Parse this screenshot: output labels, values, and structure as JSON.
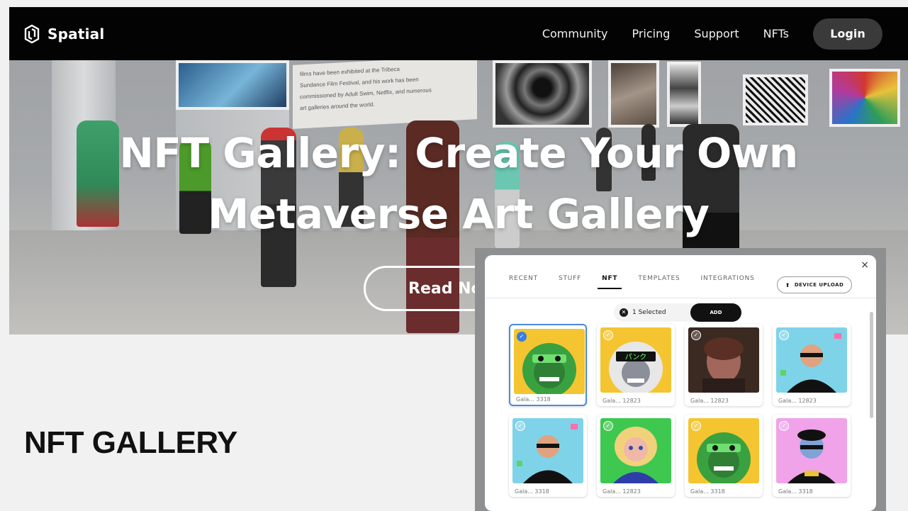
{
  "header": {
    "logo_text": "Spatial",
    "nav": [
      "Community",
      "Pricing",
      "Support",
      "NFTs"
    ],
    "login_label": "Login"
  },
  "hero": {
    "title_line1": "NFT Gallery: Create Your Own",
    "title_line2": "Metaverse Art Gallery",
    "cta_label": "Read Now",
    "info_panel_lines": [
      "films have been exhibited at the Tribeca",
      "Sundance Film Festival, and his work has been",
      "commissioned by Adult Swim, Netflix, and numerous",
      "art galleries around the world."
    ]
  },
  "section_title": "NFT GALLERY",
  "modal": {
    "close_glyph": "×",
    "tabs": [
      "RECENT",
      "STUFF",
      "NFT",
      "TEMPLATES",
      "INTEGRATIONS"
    ],
    "active_tab": "NFT",
    "device_upload_label": "DEVICE UPLOAD",
    "selected_text": "1 Selected",
    "add_label": "ADD",
    "cards": [
      {
        "label": "Gala... 3318",
        "art": "green-ape",
        "bg": "#f4c531",
        "selected": true
      },
      {
        "label": "Gala... 12823",
        "art": "white-ape",
        "bg": "#f4c531",
        "selected": false
      },
      {
        "label": "Gala... 12823",
        "art": "portrait",
        "bg": "#3b2a22",
        "selected": false
      },
      {
        "label": "Gala... 12823",
        "art": "bald-man",
        "bg": "#7fd3e8",
        "selected": false
      },
      {
        "label": "Gala... 3318",
        "art": "bald-man",
        "bg": "#7fd3e8",
        "selected": false
      },
      {
        "label": "Gala... 12823",
        "art": "blonde",
        "bg": "#3ec850",
        "selected": false
      },
      {
        "label": "Gala... 3318",
        "art": "green-ape",
        "bg": "#f4c531",
        "selected": false
      },
      {
        "label": "Gala... 3318",
        "art": "blue-man",
        "bg": "#f0a3e8",
        "selected": false
      }
    ]
  },
  "colors": {
    "selection_blue": "#3a7fe0",
    "header_bg": "#030303"
  }
}
